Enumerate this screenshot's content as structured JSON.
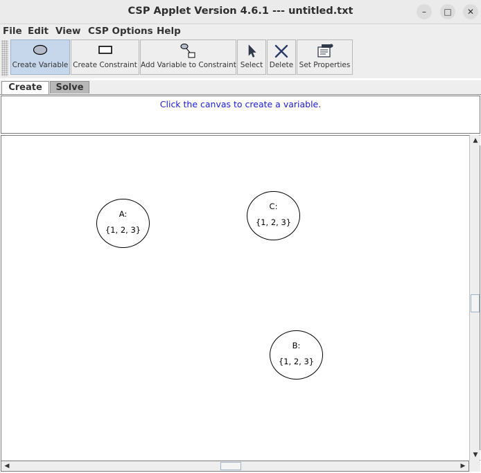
{
  "window": {
    "title": "CSP Applet Version 4.6.1 --- untitled.txt",
    "controls": [
      "minimize-icon",
      "maximize-icon",
      "close-icon"
    ]
  },
  "menu": [
    {
      "label": "File"
    },
    {
      "label": "Edit"
    },
    {
      "label": "View"
    },
    {
      "label": "CSP Options"
    },
    {
      "label": "Help"
    }
  ],
  "toolbar": {
    "buttons": [
      {
        "label": "Create Variable",
        "icon": "ellipse-icon",
        "active": true
      },
      {
        "label": "Create Constraint",
        "icon": "rectangle-icon",
        "active": false
      },
      {
        "label": "Add Variable to Constraint",
        "icon": "link-icon",
        "active": false
      },
      {
        "label": "Select",
        "icon": "cursor-icon",
        "active": false
      },
      {
        "label": "Delete",
        "icon": "delete-x-icon",
        "active": false
      },
      {
        "label": "Set Properties",
        "icon": "properties-icon",
        "active": false
      }
    ]
  },
  "tabs": [
    {
      "label": "Create",
      "selected": true
    },
    {
      "label": "Solve",
      "selected": false
    }
  ],
  "message": "Click the canvas to create a variable.",
  "colors": {
    "message": "#1a1ad6",
    "active_button": "#c6d7ec",
    "unselected_tab": "#b8b8b8"
  },
  "canvas": {
    "variables": [
      {
        "name": "A:",
        "domain": "{1, 2, 3}"
      },
      {
        "name": "C:",
        "domain": "{1, 2, 3}"
      },
      {
        "name": "B:",
        "domain": "{1, 2, 3}"
      }
    ]
  }
}
